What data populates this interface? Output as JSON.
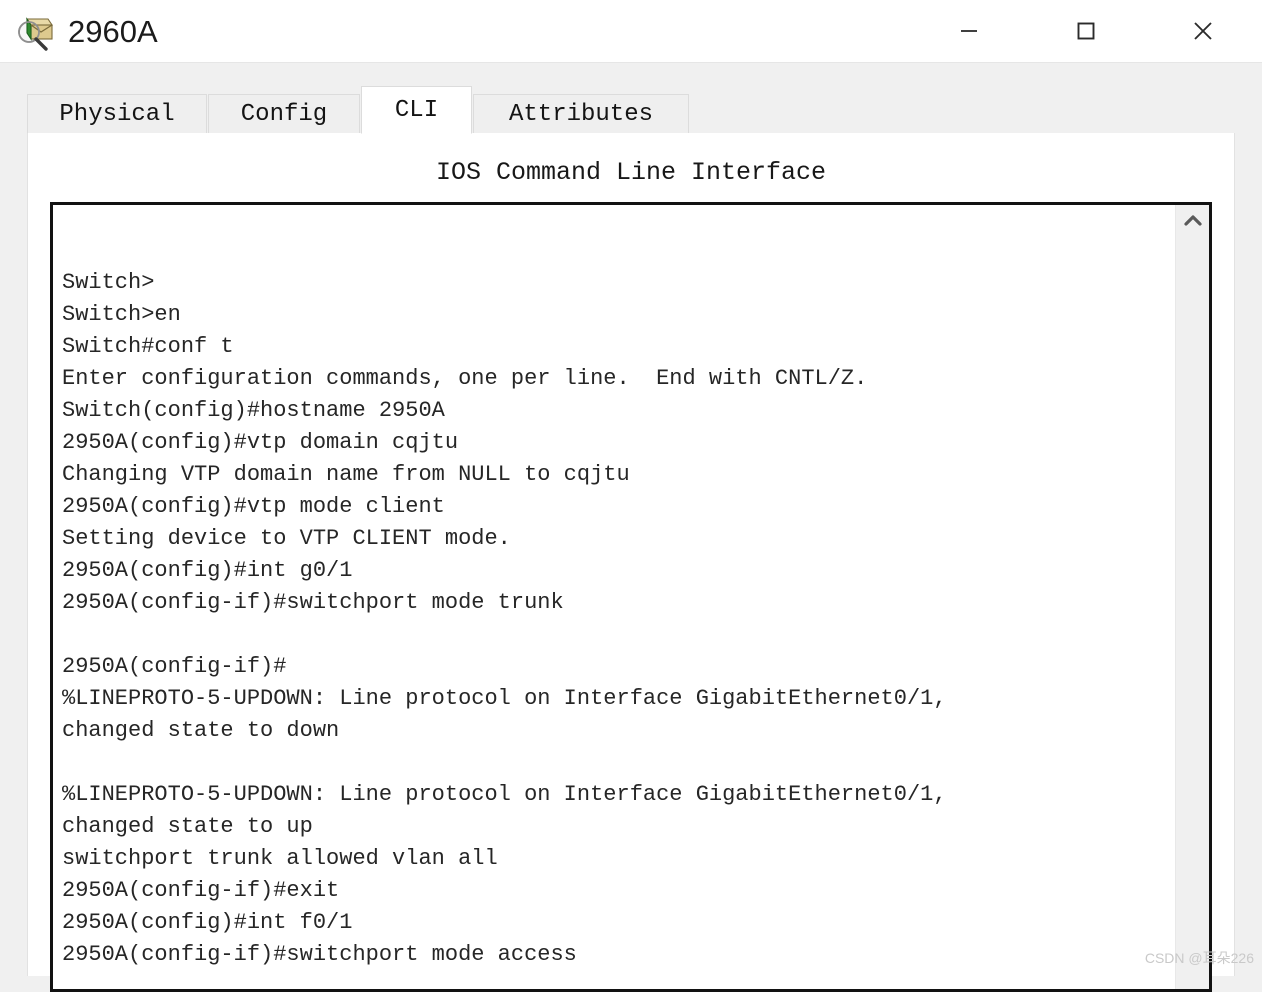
{
  "window": {
    "title": "2960A",
    "icon": "packet-inspect-icon",
    "controls": {
      "minimize": "minimize-icon",
      "maximize": "maximize-icon",
      "close": "close-icon"
    }
  },
  "tabs": [
    {
      "label": "Physical",
      "active": false
    },
    {
      "label": "Config",
      "active": false
    },
    {
      "label": "CLI",
      "active": true
    },
    {
      "label": "Attributes",
      "active": false
    }
  ],
  "panel": {
    "heading": "IOS Command Line Interface"
  },
  "terminal": {
    "lines": [
      "Switch>",
      "Switch>en",
      "Switch#conf t",
      "Enter configuration commands, one per line.  End with CNTL/Z.",
      "Switch(config)#hostname 2950A",
      "2950A(config)#vtp domain cqjtu",
      "Changing VTP domain name from NULL to cqjtu",
      "2950A(config)#vtp mode client",
      "Setting device to VTP CLIENT mode.",
      "2950A(config)#int g0/1",
      "2950A(config-if)#switchport mode trunk",
      "",
      "2950A(config-if)#",
      "%LINEPROTO-5-UPDOWN: Line protocol on Interface GigabitEthernet0/1,",
      "changed state to down",
      "",
      "%LINEPROTO-5-UPDOWN: Line protocol on Interface GigabitEthernet0/1,",
      "changed state to up",
      "switchport trunk allowed vlan all",
      "2950A(config-if)#exit",
      "2950A(config)#int f0/1",
      "2950A(config-if)#switchport mode access"
    ],
    "text": "Switch>\nSwitch>en\nSwitch#conf t\nEnter configuration commands, one per line.  End with CNTL/Z.\nSwitch(config)#hostname 2950A\n2950A(config)#vtp domain cqjtu\nChanging VTP domain name from NULL to cqjtu\n2950A(config)#vtp mode client\nSetting device to VTP CLIENT mode.\n2950A(config)#int g0/1\n2950A(config-if)#switchport mode trunk\n\n2950A(config-if)#\n%LINEPROTO-5-UPDOWN: Line protocol on Interface GigabitEthernet0/1,\nchanged state to down\n\n%LINEPROTO-5-UPDOWN: Line protocol on Interface GigabitEthernet0/1,\nchanged state to up\nswitchport trunk allowed vlan all\n2950A(config-if)#exit\n2950A(config)#int f0/1\n2950A(config-if)#switchport mode access"
  },
  "scrollbar": {
    "up_arrow": "chevron-up-icon"
  },
  "watermark": {
    "text": "CSDN @耳朵226"
  },
  "colors": {
    "window_bg": "#f0f0f0",
    "panel_bg": "#ffffff",
    "tab_inactive_bg": "#efefef",
    "tab_active_bg": "#ffffff",
    "terminal_border": "#121212",
    "terminal_text": "#262626",
    "watermark": "#c9c9c9"
  }
}
